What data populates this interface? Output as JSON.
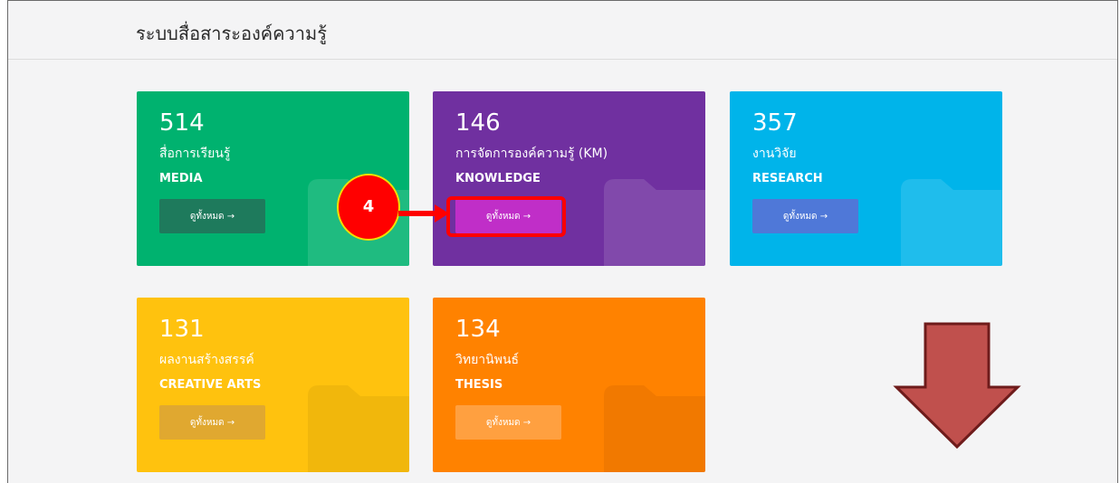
{
  "header": {
    "title": "ระบบสื่อสาระองค์ความรู้"
  },
  "cards": [
    {
      "count": "514",
      "title_th": "สื่อการเรียนรู้",
      "title_en": "MEDIA",
      "button_label": "ดูทั้งหมด →",
      "color": "#00b26f",
      "button_color": "#1e7a5c"
    },
    {
      "count": "146",
      "title_th": "การจัดการองค์ความรู้ (KM)",
      "title_en": "KNOWLEDGE",
      "button_label": "ดูทั้งหมด →",
      "color": "#7030a0",
      "button_color": "#c02ec8"
    },
    {
      "count": "357",
      "title_th": "งานวิจัย",
      "title_en": "RESEARCH",
      "button_label": "ดูทั้งหมด →",
      "color": "#00b4ea",
      "button_color": "#4f78d8"
    },
    {
      "count": "131",
      "title_th": "ผลงานสร้างสรรค์",
      "title_en": "CREATIVE ARTS",
      "button_label": "ดูทั้งหมด →",
      "color": "#ffc20e",
      "button_color": "#e0a830"
    },
    {
      "count": "134",
      "title_th": "วิทยานิพนธ์",
      "title_en": "THESIS",
      "button_label": "ดูทั้งหมด →",
      "color": "#ff8200",
      "button_color": "#ffa040"
    }
  ],
  "annotation": {
    "step_number": "4",
    "badge_color": "#ff0000",
    "arrow_color": "#c0504d"
  }
}
